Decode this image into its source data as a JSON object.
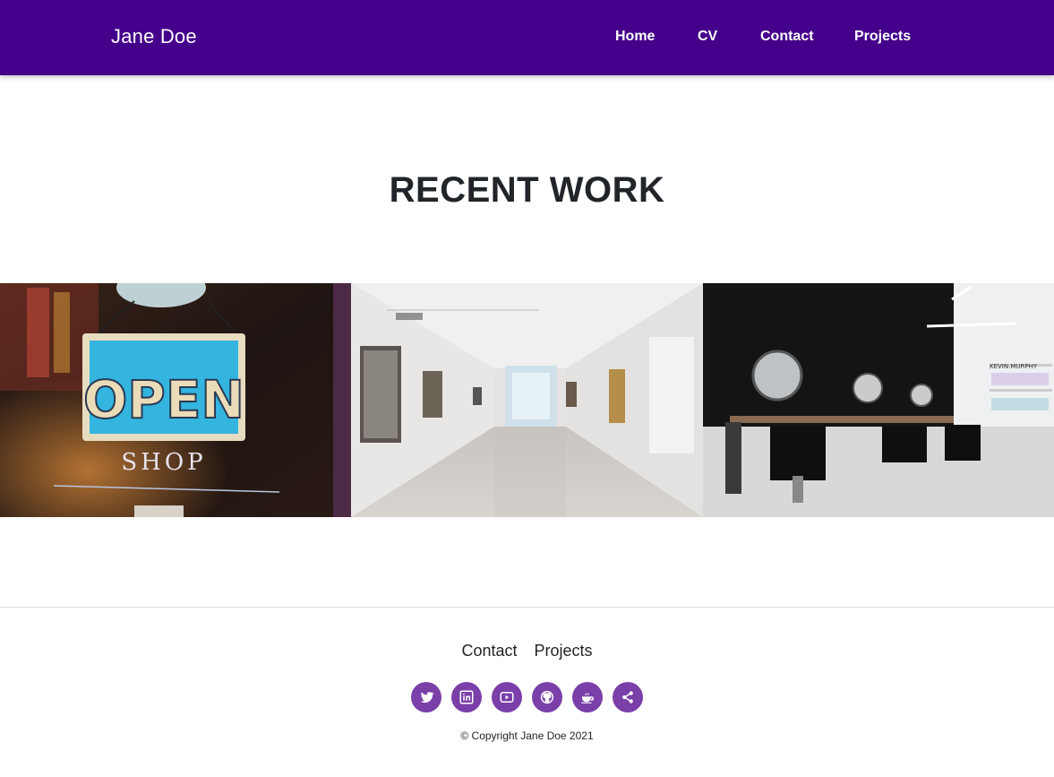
{
  "header": {
    "brand": "Jane Doe",
    "nav": [
      {
        "label": "Home"
      },
      {
        "label": "CV"
      },
      {
        "label": "Contact"
      },
      {
        "label": "Projects"
      }
    ],
    "background_color": "#44008b"
  },
  "main": {
    "heading": "RECENT WORK",
    "gallery": [
      {
        "sign_text": "OPEN",
        "sign_subtext": "SHOP"
      },
      {
        "sign_text": ""
      },
      {
        "shelf_label": "KEVIN.MURPHY"
      }
    ]
  },
  "footer": {
    "links": [
      {
        "label": "Contact"
      },
      {
        "label": "Projects"
      }
    ],
    "social_icons": [
      "twitter-icon",
      "linkedin-icon",
      "youtube-icon",
      "github-icon",
      "coffee-icon",
      "share-icon"
    ],
    "social_color": "#7a3fa8",
    "copyright": "© Copyright Jane Doe 2021"
  }
}
